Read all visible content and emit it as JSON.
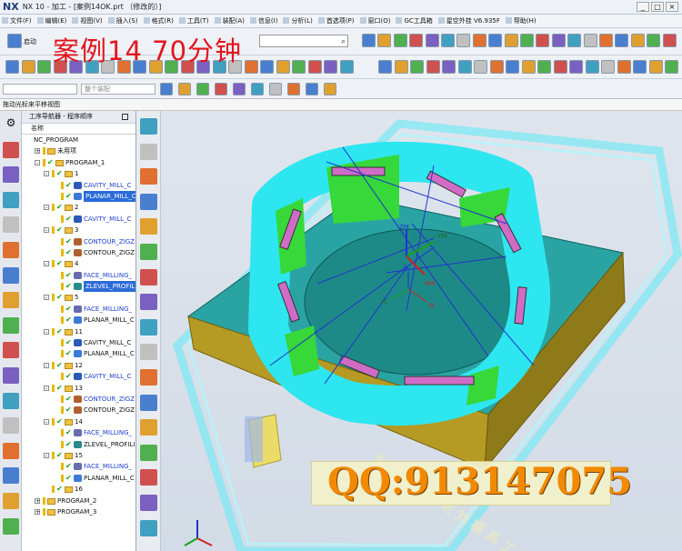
{
  "app": {
    "logo": "NX",
    "title": "NX 10 - 加工 - [案例14OK.prt （修改的）]"
  },
  "window_controls": [
    "_",
    "□",
    "×"
  ],
  "menu": [
    {
      "label": "文件(F)",
      "name": "menu-file"
    },
    {
      "label": "编辑(E)",
      "name": "menu-edit"
    },
    {
      "label": "视图(V)",
      "name": "menu-view"
    },
    {
      "label": "插入(S)",
      "name": "menu-insert"
    },
    {
      "label": "格式(R)",
      "name": "menu-format"
    },
    {
      "label": "工具(T)",
      "name": "menu-tools"
    },
    {
      "label": "装配(A)",
      "name": "menu-assembly"
    },
    {
      "label": "信息(I)",
      "name": "menu-info"
    },
    {
      "label": "分析(L)",
      "name": "menu-analysis"
    },
    {
      "label": "首选项(P)",
      "name": "menu-preferences"
    },
    {
      "label": "窗口(O)",
      "name": "menu-window"
    },
    {
      "label": "GC工具箱",
      "name": "menu-gc-toolbox"
    },
    {
      "label": "星空外挂 V6.935F",
      "name": "menu-xingkong-plugin"
    },
    {
      "label": "帮助(H)",
      "name": "menu-help"
    }
  ],
  "toolbar": {
    "start_label": "启动",
    "banner": "案例14   70分钟",
    "search_placeholder": "",
    "selection_filter": "",
    "assembly_filter": "整个装配"
  },
  "hint": "拖动光标来平移视图",
  "navigator": {
    "title": "工序导航器 - 程序顺序",
    "column_header": "名称",
    "rows": [
      {
        "level": 0,
        "text": "NC_PROGRAM",
        "exp": "",
        "kind": "root",
        "check": false,
        "color": "black"
      },
      {
        "level": 1,
        "text": "未用项",
        "exp": "+",
        "kind": "folder",
        "check": false,
        "color": "black"
      },
      {
        "level": 1,
        "text": "PROGRAM_1",
        "exp": "-",
        "kind": "program",
        "check": true,
        "color": "black"
      },
      {
        "level": 2,
        "text": "1",
        "exp": "-",
        "kind": "program",
        "check": true,
        "color": "black"
      },
      {
        "level": 3,
        "text": "CAVITY_MILL_C",
        "exp": "",
        "kind": "op-cavity",
        "check": true,
        "color": "blue"
      },
      {
        "level": 3,
        "text": "PLANAR_MILL_C",
        "exp": "",
        "kind": "op-planar",
        "check": true,
        "color": "selected"
      },
      {
        "level": 2,
        "text": "2",
        "exp": "-",
        "kind": "program",
        "check": true,
        "color": "black"
      },
      {
        "level": 3,
        "text": "CAVITY_MILL_C",
        "exp": "",
        "kind": "op-cavity",
        "check": true,
        "color": "blue"
      },
      {
        "level": 2,
        "text": "3",
        "exp": "-",
        "kind": "program",
        "check": true,
        "color": "black"
      },
      {
        "level": 3,
        "text": "CONTOUR_ZIGZ",
        "exp": "",
        "kind": "op-contour",
        "check": true,
        "color": "blue"
      },
      {
        "level": 3,
        "text": "CONTOUR_ZIGZ",
        "exp": "",
        "kind": "op-contour",
        "check": true,
        "color": "black"
      },
      {
        "level": 2,
        "text": "4",
        "exp": "-",
        "kind": "program",
        "check": true,
        "color": "black"
      },
      {
        "level": 3,
        "text": "FACE_MILLING_",
        "exp": "",
        "kind": "op-face",
        "check": true,
        "color": "blue"
      },
      {
        "level": 3,
        "text": "ZLEVEL_PROFIL",
        "exp": "",
        "kind": "op-zlevel",
        "check": true,
        "color": "selected"
      },
      {
        "level": 2,
        "text": "5",
        "exp": "-",
        "kind": "program",
        "check": true,
        "color": "black"
      },
      {
        "level": 3,
        "text": "FACE_MILLING_",
        "exp": "",
        "kind": "op-face",
        "check": true,
        "color": "blue"
      },
      {
        "level": 3,
        "text": "PLANAR_MILL_C",
        "exp": "",
        "kind": "op-planar",
        "check": true,
        "color": "black"
      },
      {
        "level": 2,
        "text": "11",
        "exp": "-",
        "kind": "program",
        "check": true,
        "color": "black"
      },
      {
        "level": 3,
        "text": "CAVITY_MILL_C",
        "exp": "",
        "kind": "op-cavity",
        "check": true,
        "color": "black"
      },
      {
        "level": 3,
        "text": "PLANAR_MILL_C",
        "exp": "",
        "kind": "op-planar",
        "check": true,
        "color": "black"
      },
      {
        "level": 2,
        "text": "12",
        "exp": "-",
        "kind": "program",
        "check": true,
        "color": "black"
      },
      {
        "level": 3,
        "text": "CAVITY_MILL_C",
        "exp": "",
        "kind": "op-cavity",
        "check": true,
        "color": "blue"
      },
      {
        "level": 2,
        "text": "13",
        "exp": "-",
        "kind": "program",
        "check": true,
        "color": "black"
      },
      {
        "level": 3,
        "text": "CONTOUR_ZIGZ",
        "exp": "",
        "kind": "op-contour",
        "check": true,
        "color": "blue"
      },
      {
        "level": 3,
        "text": "CONTOUR_ZIGZ",
        "exp": "",
        "kind": "op-contour",
        "check": true,
        "color": "black"
      },
      {
        "level": 2,
        "text": "14",
        "exp": "-",
        "kind": "program",
        "check": true,
        "color": "black"
      },
      {
        "level": 3,
        "text": "FACE_MILLING_",
        "exp": "",
        "kind": "op-face",
        "check": true,
        "color": "blue"
      },
      {
        "level": 3,
        "text": "ZLEVEL_PROFILI",
        "exp": "",
        "kind": "op-zlevel",
        "check": true,
        "color": "black"
      },
      {
        "level": 2,
        "text": "15",
        "exp": "-",
        "kind": "program",
        "check": true,
        "color": "black"
      },
      {
        "level": 3,
        "text": "FACE_MILLING_",
        "exp": "",
        "kind": "op-face",
        "check": true,
        "color": "blue"
      },
      {
        "level": 3,
        "text": "PLANAR_MILL_C",
        "exp": "",
        "kind": "op-planar",
        "check": true,
        "color": "black"
      },
      {
        "level": 2,
        "text": "16",
        "exp": "",
        "kind": "program",
        "check": true,
        "color": "black"
      },
      {
        "level": 1,
        "text": "PROGRAM_2",
        "exp": "+",
        "kind": "program",
        "check": false,
        "color": "black"
      },
      {
        "level": 1,
        "text": "PROGRAM_3",
        "exp": "+",
        "kind": "program",
        "check": false,
        "color": "black"
      }
    ]
  },
  "viewport": {
    "axis_labels": {
      "zm": "ZM",
      "ym": "YM",
      "xm": "XM",
      "zc": "ZC",
      "yc": "YC",
      "xc": "XC"
    },
    "engraving": "淘宝店铺 老刘模具工",
    "watermark": "QQ:913147075"
  },
  "colors": {
    "part_cyan": "#2ee6f0",
    "part_green": "#36d83a",
    "base_teal": "#1a9a9a",
    "base_gold": "#b59a24",
    "pocket_pink": "#e07ad0",
    "selection_blue": "#2a6bd8",
    "banner_red": "#e4141c",
    "watermark_orange": "#f28a00"
  }
}
